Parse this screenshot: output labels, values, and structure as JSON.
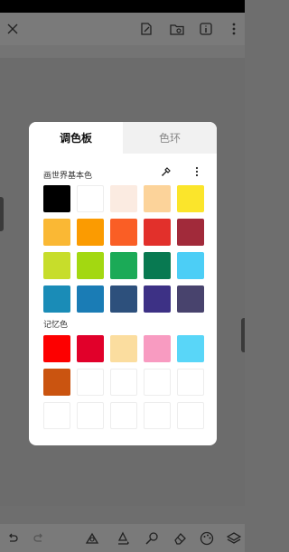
{
  "topbar": {
    "icons": [
      "close-icon",
      "edit-note-icon",
      "folder-image-icon",
      "info-icon",
      "more-vertical-icon"
    ]
  },
  "palette": {
    "tabs": [
      {
        "label": "调色板",
        "active": true
      },
      {
        "label": "色环",
        "active": false
      }
    ],
    "basic_section_title": "画世界基本色",
    "basic_colors": [
      "#000000",
      "#ffffff",
      "#fbebe1",
      "#fcd39a",
      "#fbe52b",
      "#fab834",
      "#fb9b01",
      "#fa5e25",
      "#e2302b",
      "#a12a3a",
      "#c7dd2b",
      "#a3d811",
      "#1baa57",
      "#087951",
      "#4ccef6",
      "#1a8cb7",
      "#1a7cb5",
      "#2d507c",
      "#3d3185",
      "#48436d"
    ],
    "memory_section_title": "记忆色",
    "memory_colors": [
      "#fd0000",
      "#e1002a",
      "#fbdd9f",
      "#f89bc1",
      "#59d6f8",
      "#ca5410",
      "",
      "",
      "",
      "",
      "",
      "",
      "",
      "",
      ""
    ]
  },
  "bottombar": {
    "icons": [
      "undo-icon",
      "redo-icon",
      "shape-select-icon",
      "brush-icon",
      "smudge-icon",
      "eraser-icon",
      "color-palette-icon",
      "layers-icon"
    ]
  }
}
